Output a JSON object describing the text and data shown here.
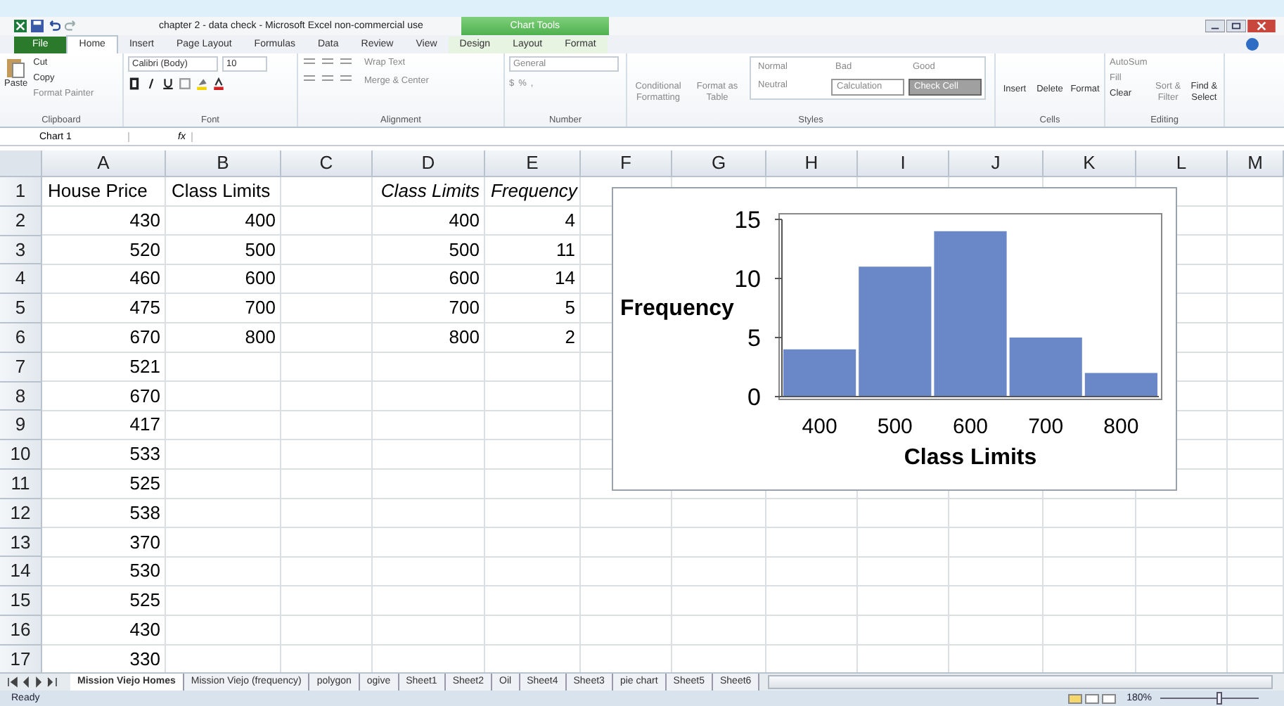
{
  "title_bar": {
    "title": "chapter 2 - data check  -  Microsoft Excel non-commercial use",
    "context_label": "Chart Tools"
  },
  "ribbon_tabs": [
    {
      "label": "File",
      "kind": "file",
      "selected": false
    },
    {
      "label": "Home",
      "kind": "main",
      "selected": true
    },
    {
      "label": "Insert",
      "kind": "main",
      "selected": false
    },
    {
      "label": "Page Layout",
      "kind": "main",
      "selected": false
    },
    {
      "label": "Formulas",
      "kind": "main",
      "selected": false
    },
    {
      "label": "Data",
      "kind": "main",
      "selected": false
    },
    {
      "label": "Review",
      "kind": "main",
      "selected": false
    },
    {
      "label": "View",
      "kind": "main",
      "selected": false
    },
    {
      "label": "Design",
      "kind": "context",
      "selected": false
    },
    {
      "label": "Layout",
      "kind": "context",
      "selected": false
    },
    {
      "label": "Format",
      "kind": "context",
      "selected": false
    }
  ],
  "clipboard": {
    "paste": "Paste",
    "cut": "Cut",
    "copy": "Copy",
    "painter": "Format Painter",
    "label": "Clipboard"
  },
  "font": {
    "family": "Calibri (Body)",
    "size": "10",
    "label": "Font"
  },
  "alignment": {
    "wrap": "Wrap Text",
    "merge": "Merge & Center",
    "label": "Alignment"
  },
  "number": {
    "format": "General",
    "currency": "$",
    "percent": "%",
    "comma": ",",
    "label": "Number"
  },
  "styles": {
    "conditional": "Conditional Formatting",
    "table": "Format as Table",
    "label": "Styles",
    "cells": [
      {
        "label": "Normal",
        "kind": "normal"
      },
      {
        "label": "Bad",
        "kind": "normal"
      },
      {
        "label": "Good",
        "kind": "normal"
      },
      {
        "label": "Neutral",
        "kind": "normal"
      },
      {
        "label": "Calculation",
        "kind": "calc"
      },
      {
        "label": "Check Cell",
        "kind": "check"
      }
    ]
  },
  "cells_group": {
    "buttons": [
      "Insert",
      "Delete",
      "Format"
    ],
    "label": "Cells"
  },
  "editing": {
    "autosum": "AutoSum",
    "fill": "Fill",
    "clear": "Clear",
    "sort": "Sort & Filter",
    "find": "Find & Select",
    "label": "Editing"
  },
  "formula_bar": {
    "name_box": "Chart 1",
    "fx": "fx"
  },
  "columns": [
    "A",
    "B",
    "C",
    "D",
    "E",
    "F",
    "G",
    "H",
    "I",
    "J",
    "K",
    "L",
    "M"
  ],
  "rows": [
    {
      "number": "1",
      "cells": [
        {
          "text": "House Price",
          "kind": "label"
        },
        {
          "text": "Class Limits",
          "kind": "label"
        },
        {
          "kind": "empty"
        },
        {
          "text": "Class Limits",
          "kind": "emphasis"
        },
        {
          "text": "Frequency",
          "kind": "emphasis"
        }
      ]
    },
    {
      "number": "2",
      "cells": [
        {
          "text": "430",
          "kind": "number"
        },
        {
          "text": "400",
          "kind": "number"
        },
        {
          "kind": "empty"
        },
        {
          "text": "400",
          "kind": "number"
        },
        {
          "text": "4",
          "kind": "number"
        }
      ]
    },
    {
      "number": "3",
      "cells": [
        {
          "text": "520",
          "kind": "number"
        },
        {
          "text": "500",
          "kind": "number"
        },
        {
          "kind": "empty"
        },
        {
          "text": "500",
          "kind": "number"
        },
        {
          "text": "11",
          "kind": "number"
        }
      ]
    },
    {
      "number": "4",
      "cells": [
        {
          "text": "460",
          "kind": "number"
        },
        {
          "text": "600",
          "kind": "number"
        },
        {
          "kind": "empty"
        },
        {
          "text": "600",
          "kind": "number"
        },
        {
          "text": "14",
          "kind": "number"
        }
      ]
    },
    {
      "number": "5",
      "cells": [
        {
          "text": "475",
          "kind": "number"
        },
        {
          "text": "700",
          "kind": "number"
        },
        {
          "kind": "empty"
        },
        {
          "text": "700",
          "kind": "number"
        },
        {
          "text": "5",
          "kind": "number"
        }
      ]
    },
    {
      "number": "6",
      "cells": [
        {
          "text": "670",
          "kind": "number"
        },
        {
          "text": "800",
          "kind": "number"
        },
        {
          "kind": "empty"
        },
        {
          "text": "800",
          "kind": "number"
        },
        {
          "text": "2",
          "kind": "number"
        }
      ]
    },
    {
      "number": "7",
      "cells": [
        {
          "text": "521",
          "kind": "number"
        }
      ]
    },
    {
      "number": "8",
      "cells": [
        {
          "text": "670",
          "kind": "number"
        }
      ]
    },
    {
      "number": "9",
      "cells": [
        {
          "text": "417",
          "kind": "number"
        }
      ]
    },
    {
      "number": "10",
      "cells": [
        {
          "text": "533",
          "kind": "number"
        }
      ]
    },
    {
      "number": "11",
      "cells": [
        {
          "text": "525",
          "kind": "number"
        }
      ]
    },
    {
      "number": "12",
      "cells": [
        {
          "text": "538",
          "kind": "number"
        }
      ]
    },
    {
      "number": "13",
      "cells": [
        {
          "text": "370",
          "kind": "number"
        }
      ]
    },
    {
      "number": "14",
      "cells": [
        {
          "text": "530",
          "kind": "number"
        }
      ]
    },
    {
      "number": "15",
      "cells": [
        {
          "text": "525",
          "kind": "number"
        }
      ]
    },
    {
      "number": "16",
      "cells": [
        {
          "text": "430",
          "kind": "number"
        }
      ]
    },
    {
      "number": "17",
      "cells": [
        {
          "text": "330",
          "kind": "number"
        }
      ]
    }
  ],
  "chart": {
    "chart_data": {
      "type": "bar",
      "xlabel": "Class Limits",
      "ylabel": "Frequency",
      "categories": [
        "400",
        "500",
        "600",
        "700",
        "800"
      ],
      "series": [
        {
          "color": "#6a88c8",
          "values": [
            4,
            11,
            14,
            5,
            2
          ]
        }
      ],
      "ylim": [
        0,
        15
      ],
      "yticks": [
        0,
        5,
        10,
        15
      ]
    }
  },
  "sheet_tabs": [
    {
      "label": "Mission Viejo Homes",
      "selected": true
    },
    {
      "label": "Mission Viejo (frequency)",
      "selected": false
    },
    {
      "label": "polygon",
      "selected": false
    },
    {
      "label": "ogive",
      "selected": false
    },
    {
      "label": "Sheet1",
      "selected": false
    },
    {
      "label": "Sheet2",
      "selected": false
    },
    {
      "label": "Oil",
      "selected": false
    },
    {
      "label": "Sheet4",
      "selected": false
    },
    {
      "label": "Sheet3",
      "selected": false
    },
    {
      "label": "pie chart",
      "selected": false
    },
    {
      "label": "Sheet5",
      "selected": false
    },
    {
      "label": "Sheet6",
      "selected": false
    }
  ],
  "status_bar": {
    "state": "Ready",
    "zoom": "180%",
    "zoom_level": {
      "level": 0.6
    }
  }
}
